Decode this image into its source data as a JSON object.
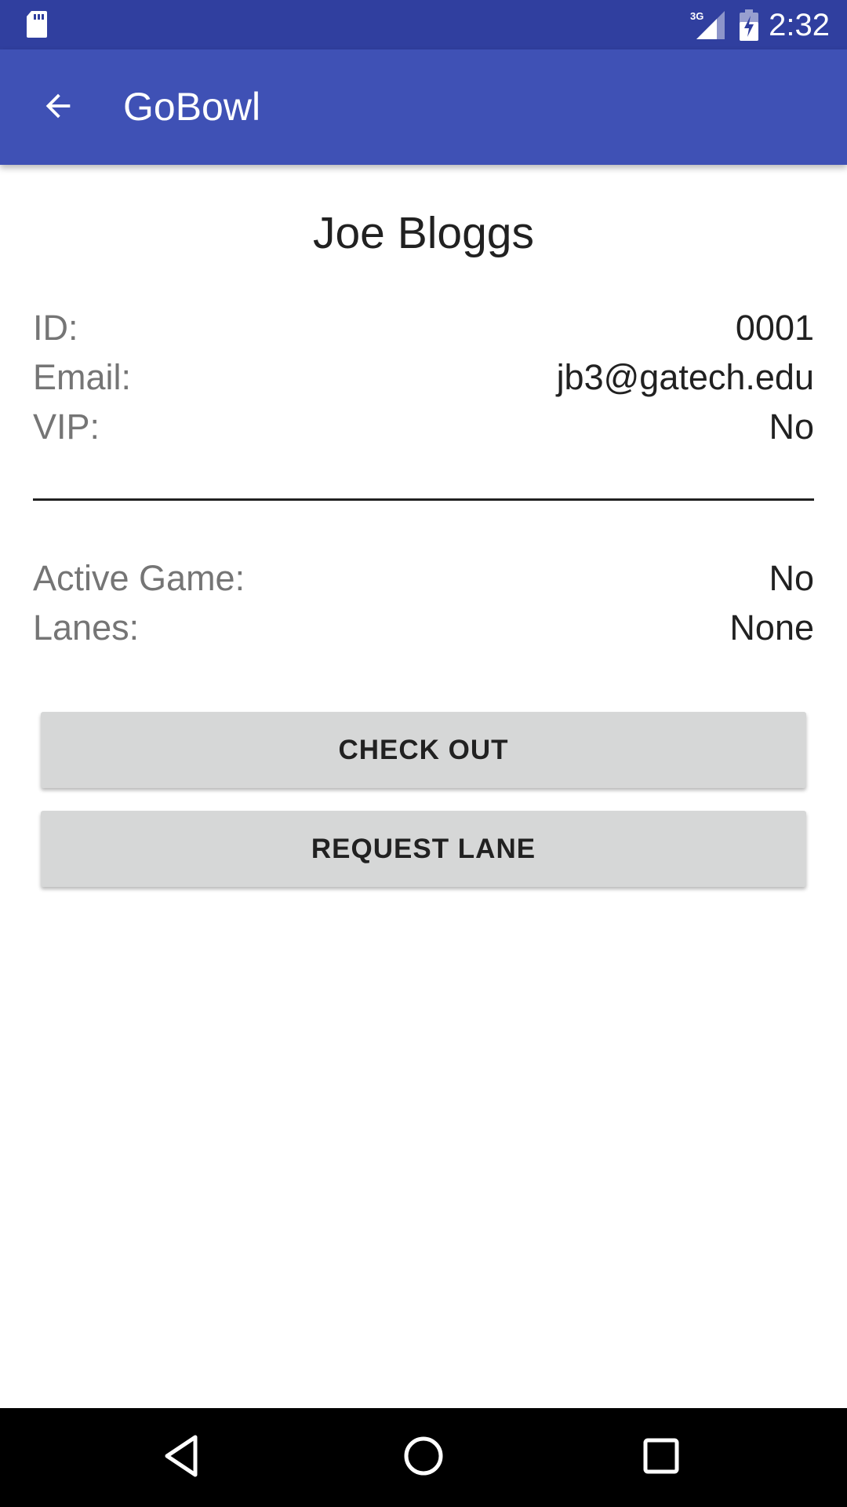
{
  "status_bar": {
    "time": "2:32",
    "network_label": "3G",
    "icons": [
      "sd-card-icon",
      "signal-3g-icon",
      "battery-charging-icon"
    ]
  },
  "app_bar": {
    "title": "GoBowl",
    "back_icon": "arrow-back-icon"
  },
  "profile": {
    "name": "Joe Bloggs",
    "details": [
      {
        "label": "ID:",
        "value": "0001"
      },
      {
        "label": "Email:",
        "value": "jb3@gatech.edu"
      },
      {
        "label": "VIP:",
        "value": "No"
      }
    ],
    "status": [
      {
        "label": "Active Game:",
        "value": "No"
      },
      {
        "label": "Lanes:",
        "value": "None"
      }
    ]
  },
  "actions": {
    "check_out_label": "CHECK OUT",
    "request_lane_label": "REQUEST LANE"
  },
  "nav_bar": {
    "icons": [
      "nav-back-icon",
      "nav-home-icon",
      "nav-recents-icon"
    ]
  },
  "colors": {
    "status_bar": "#303f9f",
    "app_bar": "#3f51b5",
    "button": "#d6d7d7",
    "label_text": "#757575",
    "value_text": "#212121"
  }
}
